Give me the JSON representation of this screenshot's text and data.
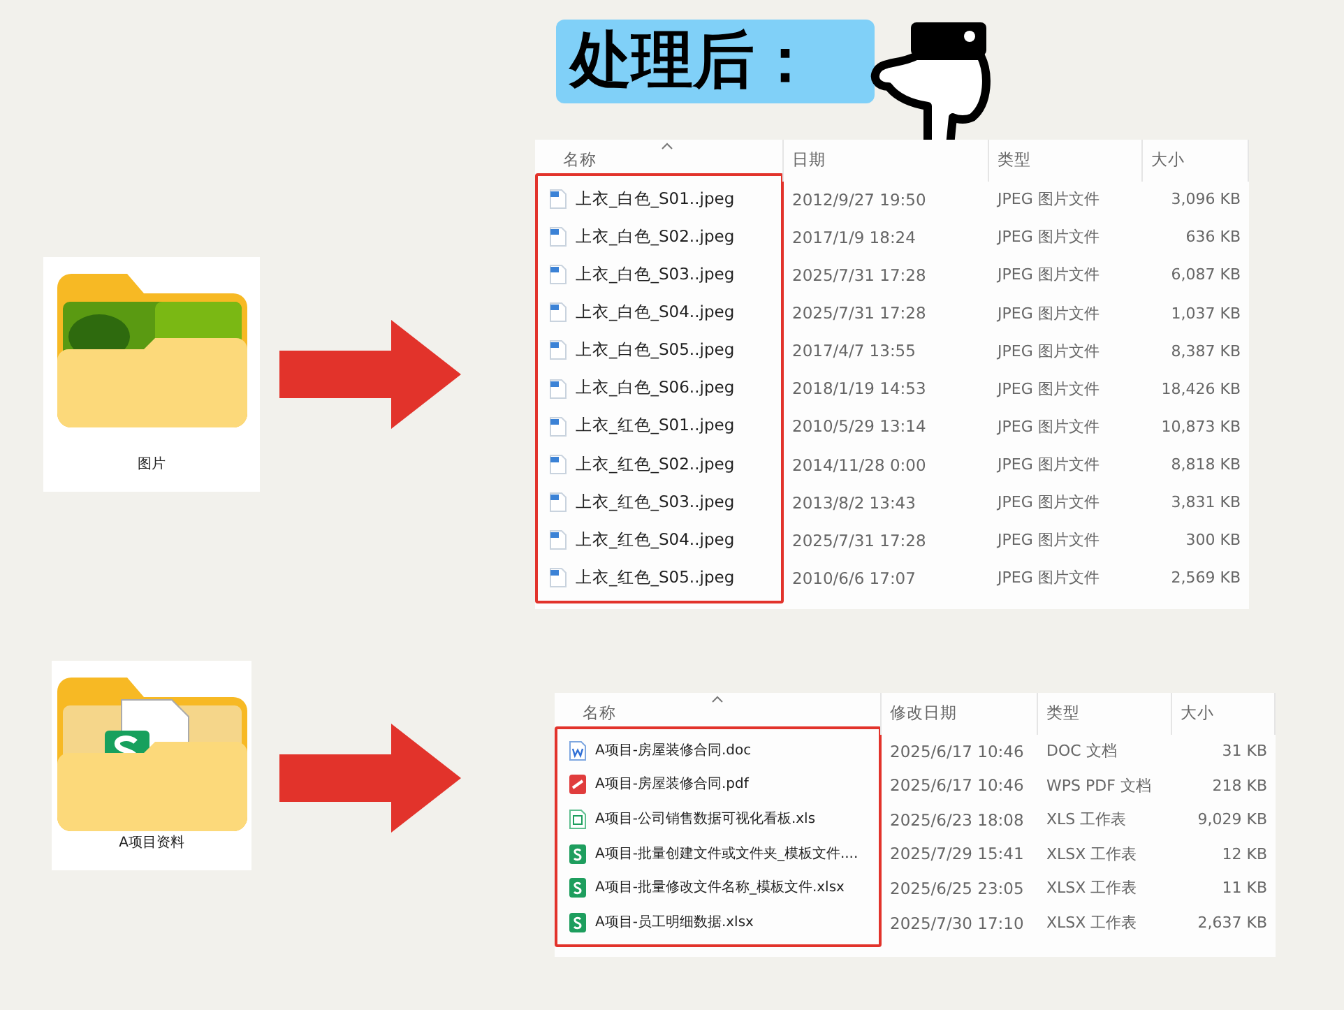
{
  "title": "处理后：",
  "sections": [
    {
      "folder": {
        "name": "图片",
        "kind": "photos"
      },
      "columns": [
        "名称",
        "日期",
        "类型",
        "大小"
      ],
      "files": [
        {
          "name": "上衣_白色_S01..jpeg",
          "date": "2012/9/27 19:50",
          "type": "JPEG 图片文件",
          "size": "3,096 KB",
          "kind": "image"
        },
        {
          "name": "上衣_白色_S02..jpeg",
          "date": "2017/1/9 18:24",
          "type": "JPEG 图片文件",
          "size": "636 KB",
          "kind": "image"
        },
        {
          "name": "上衣_白色_S03..jpeg",
          "date": "2025/7/31 17:28",
          "type": "JPEG 图片文件",
          "size": "6,087 KB",
          "kind": "image"
        },
        {
          "name": "上衣_白色_S04..jpeg",
          "date": "2025/7/31 17:28",
          "type": "JPEG 图片文件",
          "size": "1,037 KB",
          "kind": "image"
        },
        {
          "name": "上衣_白色_S05..jpeg",
          "date": "2017/4/7 13:55",
          "type": "JPEG 图片文件",
          "size": "8,387 KB",
          "kind": "image"
        },
        {
          "name": "上衣_白色_S06..jpeg",
          "date": "2018/1/19 14:53",
          "type": "JPEG 图片文件",
          "size": "18,426 KB",
          "kind": "image"
        },
        {
          "name": "上衣_红色_S01..jpeg",
          "date": "2010/5/29 13:14",
          "type": "JPEG 图片文件",
          "size": "10,873 KB",
          "kind": "image"
        },
        {
          "name": "上衣_红色_S02..jpeg",
          "date": "2014/11/28 0:00",
          "type": "JPEG 图片文件",
          "size": "8,818 KB",
          "kind": "image"
        },
        {
          "name": "上衣_红色_S03..jpeg",
          "date": "2013/8/2 13:43",
          "type": "JPEG 图片文件",
          "size": "3,831 KB",
          "kind": "image"
        },
        {
          "name": "上衣_红色_S04..jpeg",
          "date": "2025/7/31 17:28",
          "type": "JPEG 图片文件",
          "size": "300 KB",
          "kind": "image"
        },
        {
          "name": "上衣_红色_S05..jpeg",
          "date": "2010/6/6 17:07",
          "type": "JPEG 图片文件",
          "size": "2,569 KB",
          "kind": "image"
        }
      ]
    },
    {
      "folder": {
        "name": "A项目资料",
        "kind": "documents"
      },
      "columns": [
        "名称",
        "修改日期",
        "类型",
        "大小"
      ],
      "files": [
        {
          "name": "A项目-房屋装修合同.doc",
          "date": "2025/6/17 10:46",
          "type": "DOC 文档",
          "size": "31 KB",
          "kind": "word"
        },
        {
          "name": "A项目-房屋装修合同.pdf",
          "date": "2025/6/17 10:46",
          "type": "WPS PDF 文档",
          "size": "218 KB",
          "kind": "pdf"
        },
        {
          "name": "A项目-公司销售数据可视化看板.xls",
          "date": "2025/6/23 18:08",
          "type": "XLS 工作表",
          "size": "9,029 KB",
          "kind": "xls"
        },
        {
          "name": "A项目-批量创建文件或文件夹_模板文件....",
          "date": "2025/7/29 15:41",
          "type": "XLSX 工作表",
          "size": "12 KB",
          "kind": "xlsx"
        },
        {
          "name": "A项目-批量修改文件名称_模板文件.xlsx",
          "date": "2025/6/25 23:05",
          "type": "XLSX 工作表",
          "size": "11 KB",
          "kind": "xlsx"
        },
        {
          "name": "A项目-员工明细数据.xlsx",
          "date": "2025/7/30 17:10",
          "type": "XLSX 工作表",
          "size": "2,637 KB",
          "kind": "xlsx"
        }
      ]
    }
  ]
}
